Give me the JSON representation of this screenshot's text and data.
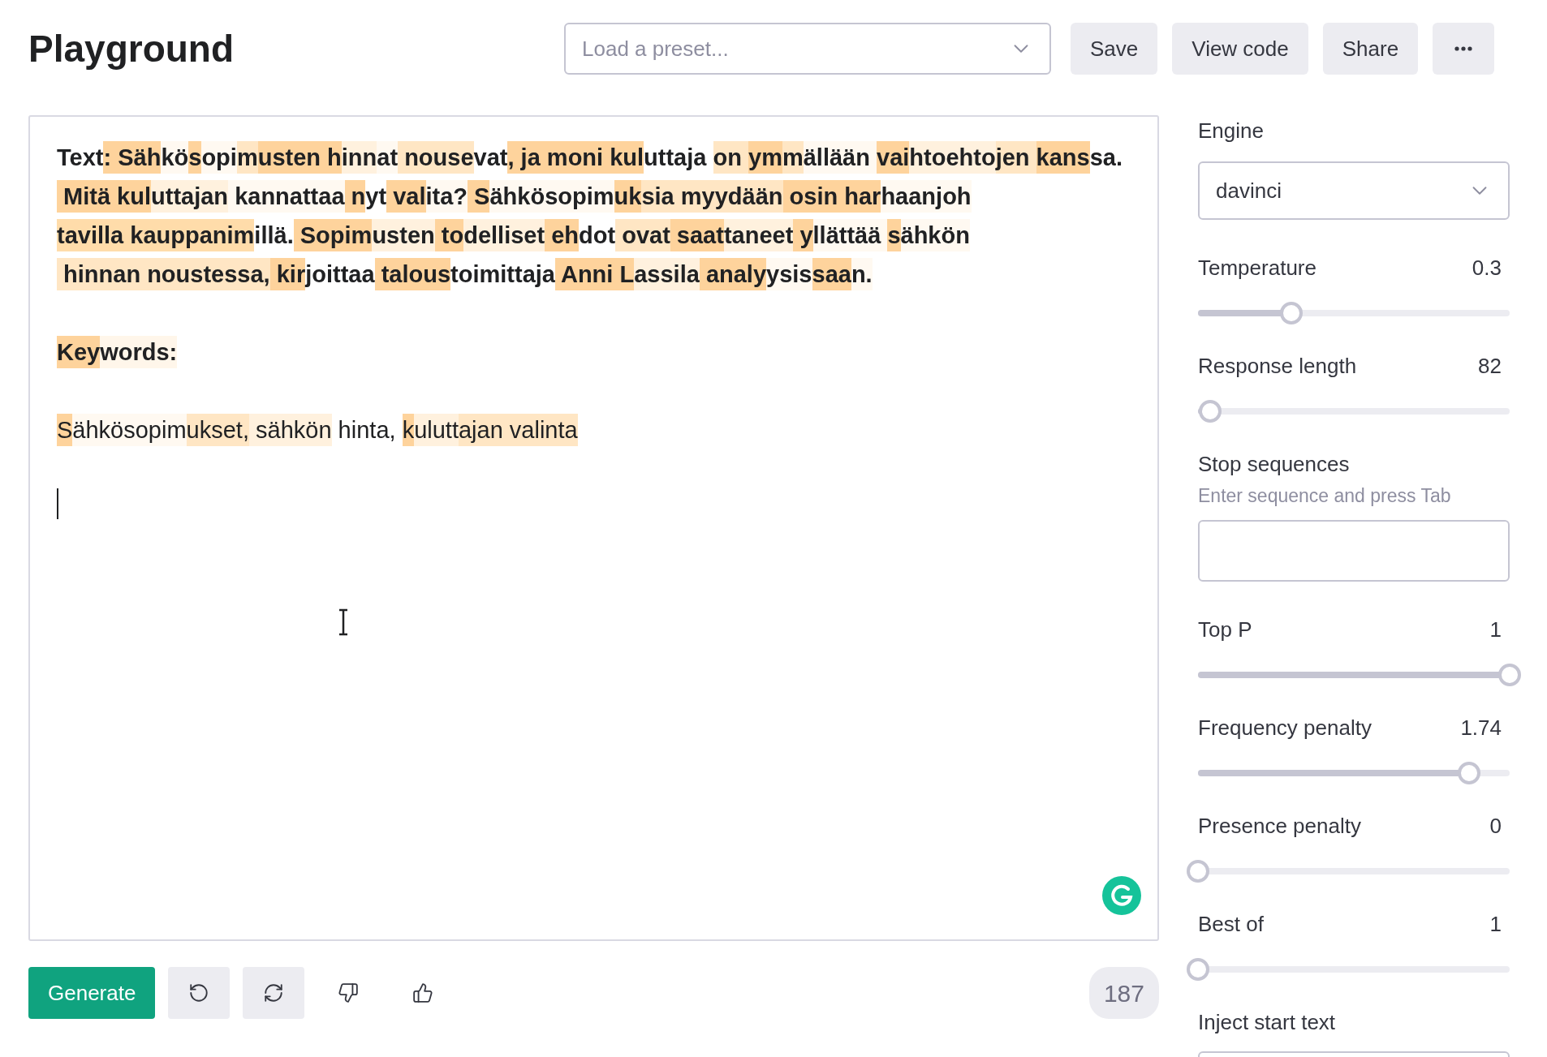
{
  "header": {
    "title": "Playground",
    "preset": {
      "placeholder": "Load a preset..."
    },
    "buttons": [
      "Save",
      "View code",
      "Share"
    ]
  },
  "editor": {
    "paragraphs": [
      {
        "bold": true,
        "segments": [
          {
            "text": "Text"
          },
          {
            "text": ": Säh",
            "color": "#fed39c"
          },
          {
            "text": "kö",
            "color": "#fff9f1"
          },
          {
            "text": "s",
            "color": "#fed39c"
          },
          {
            "text": "opi",
            "color": "#fff9f1"
          },
          {
            "text": "m",
            "color": "#ffe6c4"
          },
          {
            "text": "usten ",
            "color": "#fed39c"
          },
          {
            "text": "h",
            "color": "#fed39c"
          },
          {
            "text": "inn",
            "color": "#fff1de"
          },
          {
            "text": "at",
            "color": "#fff9f1"
          },
          {
            "text": " nouse",
            "color": "#ffe6c4"
          },
          {
            "text": "vat"
          },
          {
            "text": ", ja moni",
            "color": "#fed39c"
          },
          {
            "text": " kul",
            "color": "#fed39c"
          },
          {
            "text": "uttaja "
          },
          {
            "text": "on ",
            "color": "#ffe6c4"
          },
          {
            "text": "ym",
            "color": "#fed39c"
          },
          {
            "text": "m",
            "color": "#ffe6c4"
          },
          {
            "text": "ällään ",
            "color": "#fff9f1"
          },
          {
            "text": "vai",
            "color": "#fed39c"
          },
          {
            "text": "htoehto",
            "color": "#fff1de"
          },
          {
            "text": "jen ",
            "color": "#ffe6c4"
          },
          {
            "text": "kans",
            "color": "#fed39c"
          },
          {
            "text": "sa."
          },
          {
            "text": " Mitä",
            "color": "#fed39c"
          },
          {
            "text": " kul",
            "color": "#fed39c"
          },
          {
            "text": "uttajan",
            "color": "#fff1de"
          },
          {
            "text": " kannattaa",
            "color": "#fff9f1"
          },
          {
            "text": " n",
            "color": "#fed39c"
          },
          {
            "text": "yt"
          },
          {
            "text": " val",
            "color": "#fed39c"
          },
          {
            "text": "ita?",
            "color": "#fff9f1"
          },
          {
            "text": " S",
            "color": "#fed39c"
          },
          {
            "text": "ähkösopim",
            "color": "#fff9f1"
          },
          {
            "text": "uk",
            "color": "#fed39c"
          },
          {
            "text": "sia myydään",
            "color": "#ffe6c4"
          },
          {
            "text": " osin ",
            "color": "#fed39c"
          },
          {
            "text": "har",
            "color": "#fed39c"
          },
          {
            "text": "haanjoh",
            "color": "#fff9f1"
          },
          {
            "text": "tavilla kauppanim",
            "color": "#ffdcaa"
          },
          {
            "text": "illä."
          },
          {
            "text": " Sopim",
            "color": "#fed39c"
          },
          {
            "text": "usten",
            "color": "#fff1de"
          },
          {
            "text": " to",
            "color": "#fed39c"
          },
          {
            "text": "delliset",
            "color": "#fff1de"
          },
          {
            "text": " eh",
            "color": "#fed39c"
          },
          {
            "text": "dot"
          },
          {
            "text": " ovat",
            "color": "#ffe6c4"
          },
          {
            "text": " saat",
            "color": "#fed39c"
          },
          {
            "text": "taneet",
            "color": "#fff1de"
          },
          {
            "text": " y",
            "color": "#fed39c"
          },
          {
            "text": "llättää ",
            "color": "#fff9f1"
          },
          {
            "text": "s",
            "color": "#fed39c"
          },
          {
            "text": "ähkön",
            "color": "#fff9f1"
          },
          {
            "text": " hinnan noustessa,",
            "color": "#ffe6c4"
          },
          {
            "text": " kir",
            "color": "#fed39c"
          },
          {
            "text": "joittaa"
          },
          {
            "text": " talous",
            "color": "#fed39c"
          },
          {
            "text": "toimittaja"
          },
          {
            "text": " Anni",
            "color": "#fed39c"
          },
          {
            "text": " L",
            "color": "#fed39c"
          },
          {
            "text": "assila",
            "color": "#fff1de"
          },
          {
            "text": " analy",
            "color": "#fed39c"
          },
          {
            "text": "ysis",
            "color": "#fff9f1"
          },
          {
            "text": "saa",
            "color": "#fed39c"
          },
          {
            "text": "n.",
            "color": "#fff9f1"
          }
        ]
      },
      {
        "bold": true,
        "segments": [
          {
            "text": "Key",
            "color": "#fed39c"
          },
          {
            "text": "words:",
            "color": "#fff6ea"
          }
        ]
      },
      {
        "bold": false,
        "segments": [
          {
            "text": "S",
            "color": "#fed39c"
          },
          {
            "text": "ähkösopim",
            "color": "#fff9f1"
          },
          {
            "text": "uk",
            "color": "#ffe6c4"
          },
          {
            "text": "set,",
            "color": "#ffe6c4"
          },
          {
            "text": " sähkön",
            "color": "#fff1de"
          },
          {
            "text": " hinta, "
          },
          {
            "text": "k",
            "color": "#fed39c"
          },
          {
            "text": "ulutt",
            "color": "#fff1de"
          },
          {
            "text": "ajan valinta",
            "color": "#ffe6c4"
          }
        ]
      }
    ]
  },
  "footer": {
    "generate": "Generate",
    "token_count": "187"
  },
  "settings": [
    {
      "kind": "select",
      "label": "Engine",
      "value": "davinci"
    },
    {
      "kind": "slider",
      "label": "Temperature",
      "reading": "0.3",
      "level": 0.3
    },
    {
      "kind": "slider",
      "label": "Response length",
      "reading": "82",
      "level": 0.04
    },
    {
      "kind": "tags",
      "label": "Stop sequences",
      "hint": "Enter sequence and press Tab"
    },
    {
      "kind": "slider",
      "label": "Top P",
      "reading": "1",
      "level": 1
    },
    {
      "kind": "slider",
      "label": "Frequency penalty",
      "reading": "1.74",
      "level": 0.87
    },
    {
      "kind": "slider",
      "label": "Presence penalty",
      "reading": "0",
      "level": 0
    },
    {
      "kind": "slider",
      "label": "Best of",
      "reading": "1",
      "level": 0
    },
    {
      "kind": "text",
      "label": "Inject start text"
    }
  ]
}
